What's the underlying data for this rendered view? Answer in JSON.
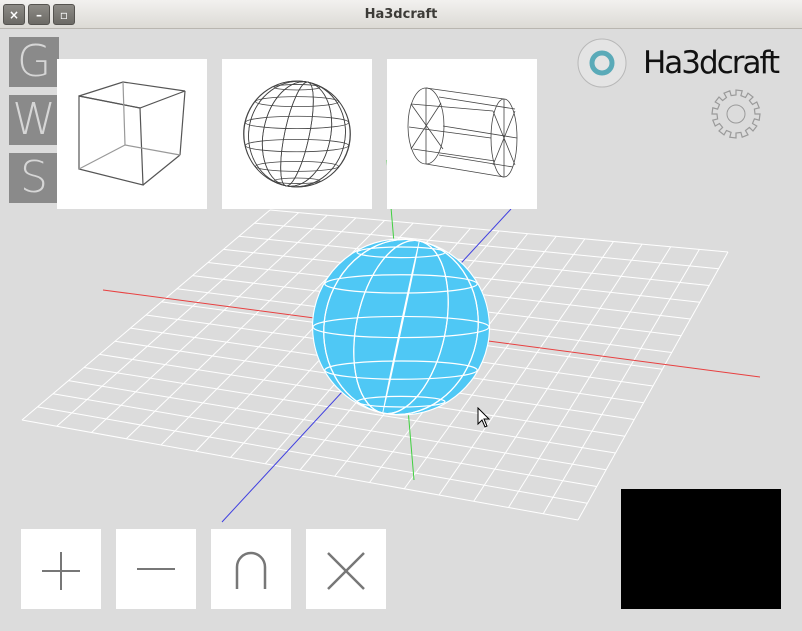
{
  "window": {
    "title": "Ha3dcraft",
    "close_glyph": "×",
    "minimize_glyph": "–",
    "maximize_glyph": "▫"
  },
  "modes": [
    {
      "letter": "G"
    },
    {
      "letter": "W"
    },
    {
      "letter": "S"
    }
  ],
  "primitives": [
    {
      "icon": "cube-wireframe-icon"
    },
    {
      "icon": "sphere-wireframe-icon"
    },
    {
      "icon": "cylinder-wireframe-icon"
    }
  ],
  "operations": [
    {
      "icon": "plus-icon"
    },
    {
      "icon": "minus-icon"
    },
    {
      "icon": "intersection-icon"
    },
    {
      "icon": "delete-x-icon"
    }
  ],
  "logo": {
    "text": "Ha3dcraft",
    "ring_color": "#5aaab8"
  },
  "settings_icon": "gear-icon",
  "viewport": {
    "selected_object": "sphere",
    "object_color": "#4fc8f5",
    "axis_colors": {
      "x": "#e84040",
      "y": "#40d040",
      "z": "#4040e0"
    },
    "grid_color": "#ffffff"
  },
  "preview_color": "#000000"
}
